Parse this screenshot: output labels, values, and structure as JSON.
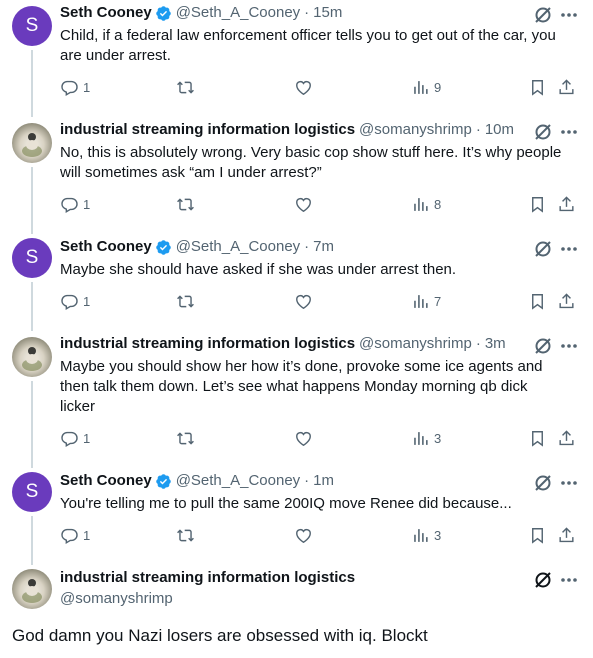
{
  "tweets": [
    {
      "name": "Seth Cooney",
      "handle": "@Seth_A_Cooney",
      "dot": "·",
      "time": "15m",
      "text": "Child, if a federal law enforcement officer tells you to get out of the car, you are under arrest.",
      "replies": "1",
      "views": "9",
      "verified": true,
      "avatar_letter": "S"
    },
    {
      "name": "industrial streaming information logistics",
      "handle": "@somanyshrimp",
      "dot": "·",
      "time": "10m",
      "text": "No, this is absolutely wrong. Very basic cop show stuff here. It’s why people will sometimes ask “am I under arrest?”",
      "replies": "1",
      "views": "8",
      "verified": false
    },
    {
      "name": "Seth Cooney",
      "handle": "@Seth_A_Cooney",
      "dot": "·",
      "time": "7m",
      "text": "Maybe she should have asked if she was under arrest then.",
      "replies": "1",
      "views": "7",
      "verified": true,
      "avatar_letter": "S"
    },
    {
      "name": "industrial streaming information logistics",
      "handle": "@somanyshrimp",
      "dot": "·",
      "time": "3m",
      "text": "Maybe you should show her how it’s done, provoke some ice agents and then talk them down. Let’s see what happens Monday morning qb dick licker",
      "replies": "1",
      "views": "3",
      "verified": false
    },
    {
      "name": "Seth Cooney",
      "handle": "@Seth_A_Cooney",
      "dot": "·",
      "time": "1m",
      "text": "You're telling me to pull the same 200IQ move Renee did because...",
      "replies": "1",
      "views": "3",
      "verified": true,
      "avatar_letter": "S"
    }
  ],
  "main_tweet": {
    "name": "industrial streaming information logistics",
    "handle": "@somanyshrimp",
    "text": "God damn you Nazi losers are obsessed with iq. Blockt"
  },
  "colors": {
    "verified": "#1d9bf0",
    "secondary_text": "#536471",
    "thread_line": "#cfd9de",
    "avatar_purple": "#6a3bbd"
  },
  "icons": [
    "reply-icon",
    "retweet-icon",
    "like-icon",
    "views-icon",
    "bookmark-icon",
    "share-icon",
    "grok-icon",
    "more-icon",
    "verified-badge-icon"
  ]
}
